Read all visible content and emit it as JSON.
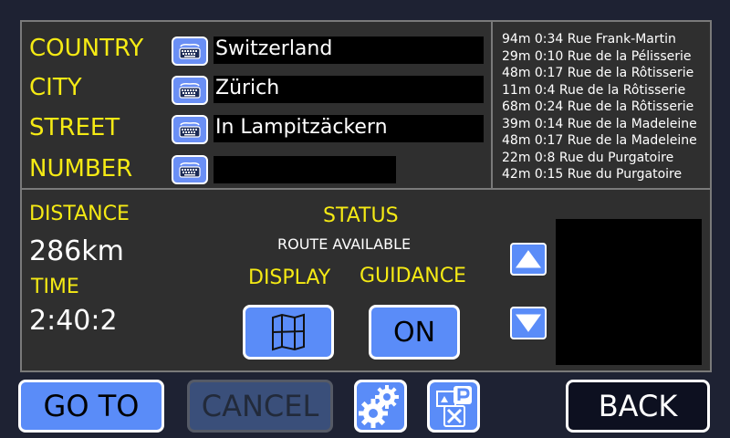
{
  "form": {
    "country_label": "COUNTRY",
    "country_value": "Switzerland",
    "city_label": "CITY",
    "city_value": "Zürich",
    "street_label": "STREET",
    "street_value": "In Lampitzäckern",
    "number_label": "NUMBER",
    "number_value": ""
  },
  "routes": [
    "94m 0:34 Rue Frank-Martin",
    "29m 0:10 Rue de la Pélisserie",
    "48m 0:17 Rue de la Rôtisserie",
    "11m 0:4 Rue de la Rôtisserie",
    "68m 0:24 Rue de la Rôtisserie",
    "39m 0:14 Rue de la Madeleine",
    "48m 0:17 Rue de la Madeleine",
    "22m 0:8 Rue du Purgatoire",
    "42m 0:15 Rue du Purgatoire"
  ],
  "info": {
    "distance_label": "DISTANCE",
    "distance_value": "286km",
    "time_label": "TIME",
    "time_value": "2:40:2",
    "status_label": "STATUS",
    "status_value": "ROUTE AVAILABLE",
    "display_label": "DISPLAY",
    "guidance_label": "GUIDANCE",
    "guidance_value": "ON"
  },
  "buttons": {
    "goto": "GO TO",
    "cancel": "CANCEL",
    "back": "BACK"
  },
  "icons": {
    "keyboard": "keyboard-icon",
    "map": "map-icon",
    "up": "arrow-up-icon",
    "down": "arrow-down-icon",
    "settings": "gears-icon",
    "poi": "poi-icon"
  },
  "colors": {
    "accent": "#5a8cf8",
    "label": "#f5ea14",
    "background": "#1e2233"
  }
}
